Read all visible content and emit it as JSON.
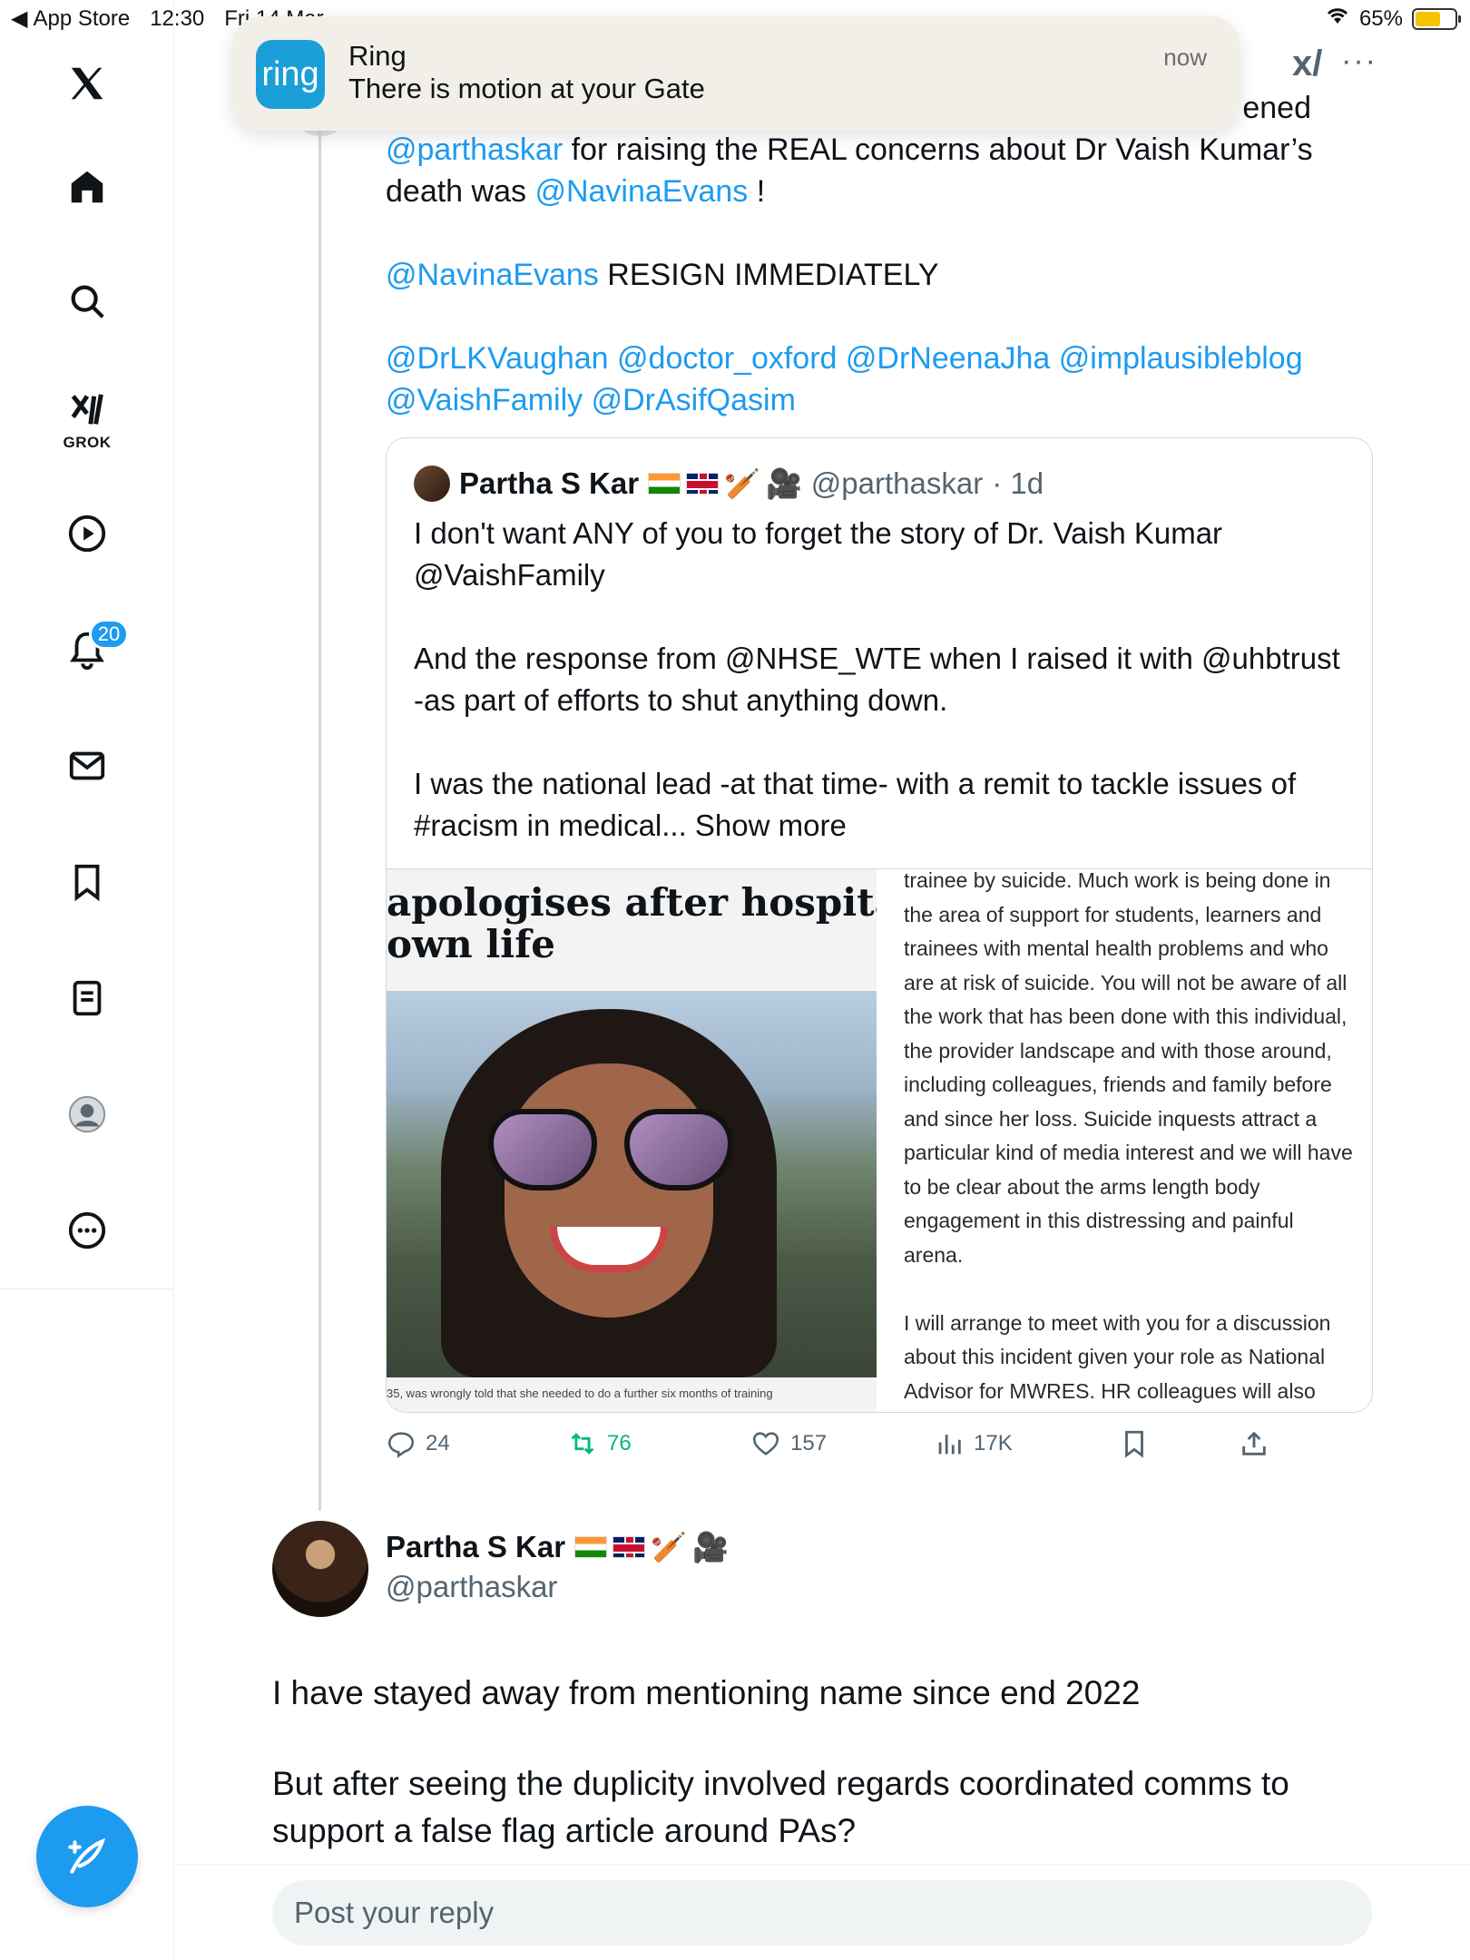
{
  "statusbar": {
    "back_app": "App Store",
    "time": "12:30",
    "date": "Fri 14 Mar",
    "battery_pct": "65%",
    "battery_level": 0.65
  },
  "sidebar": {
    "grok_label": "GROK",
    "notifications_badge": "20"
  },
  "notification": {
    "icon_text": "ring",
    "app": "Ring",
    "message": "There is motion at your Gate",
    "time": "now"
  },
  "tweet": {
    "partial_top": "ened",
    "line1_mention": "@parthaskar",
    "line1_text": " for raising the REAL concerns about Dr Vaish Kumar’s death was ",
    "line1_mention2": "@NavinaEvans",
    "line1_end": " !",
    "line2_mention": "@NavinaEvans",
    "line2_text": " RESIGN IMMEDIATELY",
    "mentions": "@DrLKVaughan @doctor_oxford @DrNeenaJha @implausibleblog @VaishFamily @DrAsifQasim"
  },
  "quote": {
    "name": "Partha S Kar",
    "handle": "@parthaskar",
    "age": "· 1d",
    "p1": "I don't want ANY of you to forget the story of Dr. Vaish Kumar @VaishFamily",
    "p2": "And the response from @NHSE_WTE when I raised it with @uhbtrust -as part of efforts to shut anything down.",
    "p3": "I was the national lead -at that time- with a remit to tackle issues of #racism in medical... Show more",
    "headline_1": "apologises after hospital do",
    "headline_2": "own life",
    "caption": "35, was wrongly told that she needed to do a further six months of training",
    "doc_p1": "trainee by suicide. Much work is being done in the area of support for students, learners and trainees with mental health problems and who are at risk of suicide. You will not be aware of all the work that has been done with this individual, the provider landscape and with those around, including colleagues, friends and family before and since her loss. Suicide inquests attract a particular kind of media interest and we will have to be clear about the arms length body engagement in this distressing and painful arena.",
    "doc_p2": "I will arrange to meet with you for a discussion about this incident given your role as National Advisor for MWRES. HR colleagues will also attend this meeting."
  },
  "actions": {
    "replies": "24",
    "reposts": "76",
    "likes": "157",
    "views": "17K"
  },
  "reply": {
    "name": "Partha S Kar",
    "handle": "@parthaskar",
    "p1": "I have stayed away from mentioning name since end 2022",
    "p2": "But after seeing the duplicity involved regards coordinated comms to support a false flag article around PAs?"
  },
  "composer": {
    "placeholder": "Post your reply"
  },
  "colors": {
    "accent": "#1d9bf0",
    "repost": "#00ba7c",
    "muted": "#536471"
  }
}
